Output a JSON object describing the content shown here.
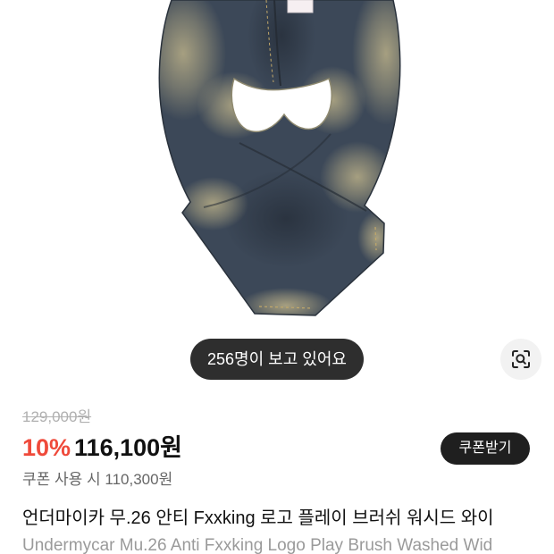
{
  "viewers_badge": {
    "text": "256명이 보고 있어요"
  },
  "visual_search_button": {
    "icon": "visual-search-icon"
  },
  "pricing": {
    "original_price": "129,000원",
    "discount_rate": "10%",
    "sale_price": "116,100원",
    "coupon_button_label": "쿠폰받기",
    "coupon_price_label": "쿠폰 사용 시",
    "coupon_price": "110,300원"
  },
  "product": {
    "title_ko": "언더마이카 무.26 안티 Fxxking 로고 플레이 브러쉬 워시드 와이",
    "title_en": "Undermycar Mu.26 Anti Fxxking Logo Play Brush Washed Wid"
  },
  "colors": {
    "discount": "#ef4a3b",
    "badge_bg": "#2e2e2e",
    "coupon_button_bg": "#1f1f1f",
    "denim": "#3c4858",
    "denim_wash": "#b2a985"
  }
}
